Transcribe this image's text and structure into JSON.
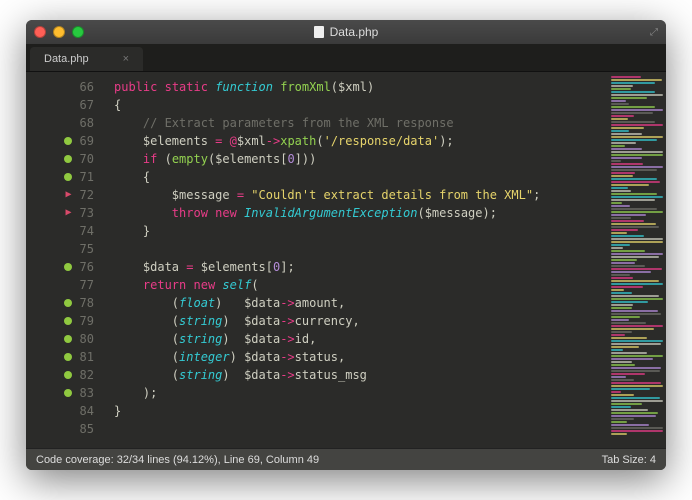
{
  "window": {
    "title": "Data.php"
  },
  "tab": {
    "label": "Data.php",
    "close": "×"
  },
  "lines": [
    {
      "n": 66,
      "cov": "",
      "html": "<span class='kw1'>public</span> <span class='kw1'>static</span> <span class='kw2'>function</span> <span class='fn'>fromXml</span>(<span class='var'>$xml</span>)"
    },
    {
      "n": 67,
      "cov": "",
      "html": "{"
    },
    {
      "n": 68,
      "cov": "",
      "html": "    <span class='cmt'>// Extract parameters from the XML response</span>"
    },
    {
      "n": 69,
      "cov": "green",
      "html": "    <span class='var'>$elements</span> <span class='op'>=</span> <span class='err'>@</span><span class='var'>$xml</span><span class='op'>-></span><span class='fn'>xpath</span>(<span class='str'>'/response/data'</span>);"
    },
    {
      "n": 70,
      "cov": "green",
      "html": "    <span class='kw1'>if</span> (<span class='fn'>empty</span>(<span class='var'>$elements</span>[<span class='num'>0</span>]))"
    },
    {
      "n": 71,
      "cov": "green",
      "html": "    {"
    },
    {
      "n": 72,
      "cov": "arrow",
      "html": "        <span class='var'>$message</span> <span class='op'>=</span> <span class='str'>\"Couldn't extract details from the XML\"</span>;"
    },
    {
      "n": 73,
      "cov": "arrow",
      "html": "        <span class='kw1'>throw</span> <span class='kw1'>new</span> <span class='ty'>InvalidArgumentException</span>(<span class='var'>$message</span>);"
    },
    {
      "n": 74,
      "cov": "",
      "html": "    }"
    },
    {
      "n": 75,
      "cov": "",
      "html": ""
    },
    {
      "n": 76,
      "cov": "green",
      "html": "    <span class='var'>$data</span> <span class='op'>=</span> <span class='var'>$elements</span>[<span class='num'>0</span>];"
    },
    {
      "n": 77,
      "cov": "",
      "html": "    <span class='kw1'>return</span> <span class='kw1'>new</span> <span class='ty'>self</span>("
    },
    {
      "n": 78,
      "cov": "green",
      "html": "        (<span class='ty'>float</span>)   <span class='var'>$data</span><span class='op'>-></span><span class='prop'>amount</span>,"
    },
    {
      "n": 79,
      "cov": "green",
      "html": "        (<span class='ty'>string</span>)  <span class='var'>$data</span><span class='op'>-></span><span class='prop'>currency</span>,"
    },
    {
      "n": 80,
      "cov": "green",
      "html": "        (<span class='ty'>string</span>)  <span class='var'>$data</span><span class='op'>-></span><span class='prop'>id</span>,"
    },
    {
      "n": 81,
      "cov": "green",
      "html": "        (<span class='ty'>integer</span>) <span class='var'>$data</span><span class='op'>-></span><span class='prop'>status</span>,"
    },
    {
      "n": 82,
      "cov": "green",
      "html": "        (<span class='ty'>string</span>)  <span class='var'>$data</span><span class='op'>-></span><span class='prop'>status_msg</span>"
    },
    {
      "n": 83,
      "cov": "green",
      "html": "    );"
    },
    {
      "n": 84,
      "cov": "",
      "html": "}"
    },
    {
      "n": 85,
      "cov": "",
      "html": ""
    }
  ],
  "status": {
    "left": "Code coverage: 32/34 lines (94.12%), Line 69, Column 49",
    "right": "Tab Size: 4"
  },
  "minimap_colors": [
    "#e83c88",
    "#34cbd3",
    "#93d250",
    "#6f6f68",
    "#e6d46b",
    "#cfcfc1",
    "#b48cd8"
  ]
}
